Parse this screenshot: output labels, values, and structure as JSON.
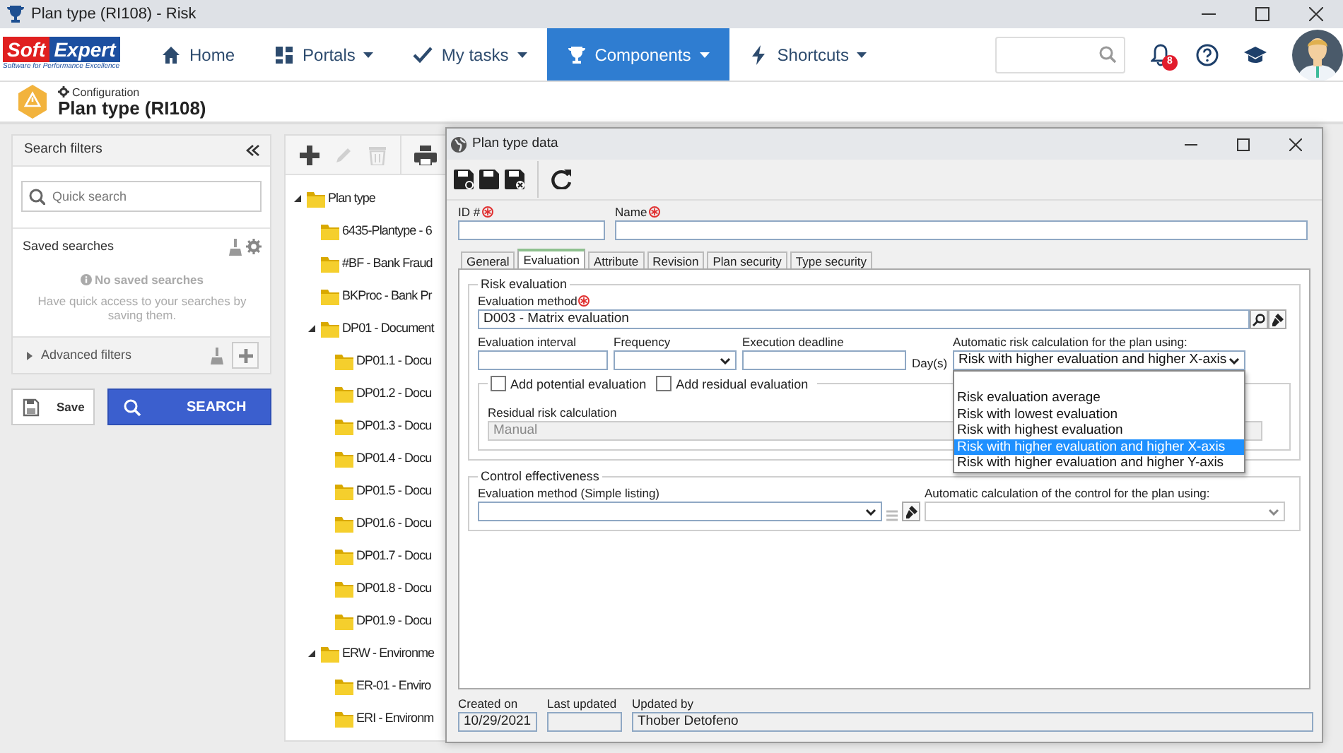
{
  "window": {
    "title": "Plan type (RI108) - Risk"
  },
  "logo": {
    "word_1": "Soft",
    "word_2": "Expert",
    "tagline": "Software for Performance Excellence"
  },
  "nav": [
    {
      "label": "Home",
      "kind": "home",
      "dropdown": false,
      "selected": false
    },
    {
      "label": "Portals",
      "kind": "grid",
      "dropdown": true,
      "selected": false
    },
    {
      "label": "My tasks",
      "kind": "check",
      "dropdown": true,
      "selected": false
    },
    {
      "label": "Components",
      "kind": "trophy",
      "dropdown": true,
      "selected": true
    },
    {
      "label": "Shortcuts",
      "kind": "bolt",
      "dropdown": true,
      "selected": false
    }
  ],
  "notifications": {
    "count": "8"
  },
  "page_header": {
    "breadcrumb": "Configuration",
    "title": "Plan type (RI108)"
  },
  "filters": {
    "title": "Search filters",
    "quick_search_placeholder": "Quick search",
    "saved_title": "Saved searches",
    "empty_title": "No saved searches",
    "empty_text": "Have quick access to your searches by saving them.",
    "advanced": "Advanced filters",
    "advanced_expanded": false,
    "save": "Save",
    "search": "SEARCH"
  },
  "tree_toolbar": [
    {
      "kind": "add",
      "disabled": false
    },
    {
      "kind": "edit",
      "disabled": true
    },
    {
      "kind": "delete",
      "disabled": true
    },
    {
      "kind": "print",
      "disabled": false
    }
  ],
  "tree": [
    {
      "label": "Plan type",
      "expanded": true,
      "children": [
        {
          "label": "6435-Plantype - 6"
        },
        {
          "label": "#BF - Bank Fraud"
        },
        {
          "label": "BKProc - Bank Pr"
        },
        {
          "label": "DP01 - Document",
          "expanded": true,
          "children": [
            {
              "label": "DP01.1 - Docu"
            },
            {
              "label": "DP01.2 - Docu"
            },
            {
              "label": "DP01.3 - Docu"
            },
            {
              "label": "DP01.4 - Docu"
            },
            {
              "label": "DP01.5 - Docu"
            },
            {
              "label": "DP01.6 - Docu"
            },
            {
              "label": "DP01.7 - Docu"
            },
            {
              "label": "DP01.8 - Docu"
            },
            {
              "label": "DP01.9 - Docu"
            }
          ]
        },
        {
          "label": "ERW - Environme",
          "expanded": true,
          "children": [
            {
              "label": "ER-01 - Enviro"
            },
            {
              "label": "ERI - Environm"
            }
          ]
        }
      ]
    }
  ],
  "dialog": {
    "title": "Plan type data",
    "toolbar": [
      {
        "kind": "save-new"
      },
      {
        "kind": "save"
      },
      {
        "kind": "save-close"
      },
      {
        "kind": "refresh"
      }
    ],
    "id_field": {
      "label": "ID #",
      "required": true
    },
    "name_field": {
      "label": "Name",
      "required": true
    },
    "tabs": [
      {
        "label": "General",
        "selected": false
      },
      {
        "label": "Evaluation",
        "selected": true
      },
      {
        "label": "Attribute",
        "selected": false
      },
      {
        "label": "Revision",
        "selected": false
      },
      {
        "label": "Plan security",
        "selected": false
      },
      {
        "label": "Type security",
        "selected": false
      }
    ],
    "risk_evaluation": {
      "legend": "Risk evaluation",
      "method": {
        "label": "Evaluation method",
        "required": true,
        "value": "D003 - Matrix evaluation"
      },
      "interval": {
        "label": "Evaluation interval"
      },
      "frequency": {
        "label": "Frequency"
      },
      "deadline": {
        "label": "Execution deadline",
        "unit": "Day(s)"
      },
      "auto_calc": {
        "label": "Automatic risk calculation for the plan using:",
        "value": "Risk with higher evaluation and higher X-axis",
        "expanded": true,
        "options": [
          {
            "label": "Risk evaluation average",
            "selected": false
          },
          {
            "label": "Risk with lowest evaluation",
            "selected": false
          },
          {
            "label": "Risk with highest evaluation",
            "selected": false
          },
          {
            "label": "Risk with higher evaluation and higher X-axis",
            "selected": true
          },
          {
            "label": "Risk with higher evaluation and higher Y-axis",
            "selected": false
          }
        ]
      },
      "potential": {
        "label": "Add potential evaluation",
        "checked": false
      },
      "residual": {
        "label": "Add residual evaluation",
        "checked": false
      },
      "residual_calc": {
        "label": "Residual risk calculation",
        "value": "Manual",
        "disabled": true
      }
    },
    "control_effectiveness": {
      "legend": "Control effectiveness",
      "method": {
        "label": "Evaluation method (Simple listing)"
      },
      "auto_calc": {
        "label": "Automatic calculation of the control for the plan using:",
        "disabled": true
      }
    },
    "footer": {
      "created_label": "Created on",
      "created": "10/29/2021",
      "updated_label": "Last updated",
      "by_label": "Updated by",
      "by": "Thober Detofeno"
    }
  }
}
